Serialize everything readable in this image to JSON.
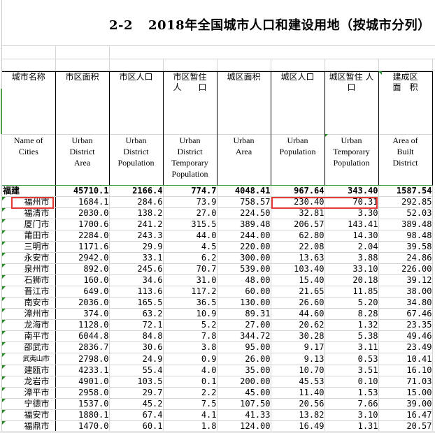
{
  "title": {
    "number": "2-2",
    "text": "2018年全国城市人口和建设用地（按城市分列）"
  },
  "columns": [
    {
      "cn": "城市名称",
      "en": "Name of\nCities"
    },
    {
      "cn": "市区面积",
      "en": "Urban\nDistrict\nArea"
    },
    {
      "cn": "市区人口",
      "en": "Urban\nDistrict\nPopulation"
    },
    {
      "cn": "市区暂住\n人　　口",
      "en": "Urban\nDistrict\nTemporary\nPopulation"
    },
    {
      "cn": "城区面积",
      "en": "Urban\nArea"
    },
    {
      "cn": "城区人口",
      "en": "Urban\nPopulation"
    },
    {
      "cn": "城区暂住 人\n口",
      "en": "Urban\nTemporary\nPopulation"
    },
    {
      "cn": "建成区\n面　积",
      "en": "Area of\nBuilt\nDistrict"
    }
  ],
  "province": {
    "name": "福建",
    "values": [
      "45710.1",
      "2166.4",
      "774.7",
      "4048.41",
      "967.64",
      "343.40",
      "1587.54"
    ]
  },
  "rows": [
    {
      "name": "福州市",
      "values": [
        "1684.1",
        "284.6",
        "73.9",
        "758.57",
        "230.40",
        "70.31",
        "292.85"
      ]
    },
    {
      "name": "福清市",
      "values": [
        "2030.0",
        "138.2",
        "27.0",
        "224.50",
        "32.81",
        "3.30",
        "52.03"
      ]
    },
    {
      "name": "厦门市",
      "values": [
        "1700.6",
        "241.2",
        "315.5",
        "389.48",
        "206.57",
        "143.41",
        "389.48"
      ]
    },
    {
      "name": "莆田市",
      "values": [
        "2284.0",
        "243.3",
        "44.0",
        "244.00",
        "62.80",
        "14.30",
        "98.48"
      ]
    },
    {
      "name": "三明市",
      "values": [
        "1171.6",
        "29.9",
        "4.5",
        "220.00",
        "22.08",
        "2.04",
        "39.58"
      ]
    },
    {
      "name": "永安市",
      "values": [
        "2942.0",
        "33.1",
        "6.2",
        "300.00",
        "13.63",
        "3.88",
        "24.86"
      ]
    },
    {
      "name": "泉州市",
      "values": [
        "892.0",
        "245.6",
        "70.7",
        "539.00",
        "103.40",
        "33.10",
        "226.00"
      ]
    },
    {
      "name": "石狮市",
      "values": [
        "160.0",
        "34.6",
        "31.0",
        "48.00",
        "15.40",
        "20.18",
        "39.12"
      ]
    },
    {
      "name": "晋江市",
      "values": [
        "649.0",
        "113.6",
        "117.2",
        "60.00",
        "21.65",
        "11.85",
        "38.00"
      ]
    },
    {
      "name": "南安市",
      "values": [
        "2036.0",
        "165.5",
        "36.5",
        "130.00",
        "26.60",
        "5.20",
        "34.80"
      ]
    },
    {
      "name": "漳州市",
      "values": [
        "374.0",
        "63.2",
        "10.9",
        "89.31",
        "44.60",
        "8.28",
        "67.46"
      ]
    },
    {
      "name": "龙海市",
      "values": [
        "1128.0",
        "72.1",
        "5.2",
        "27.00",
        "20.62",
        "1.32",
        "23.35"
      ]
    },
    {
      "name": "南平市",
      "values": [
        "6044.8",
        "84.8",
        "7.8",
        "344.72",
        "30.28",
        "5.38",
        "49.46"
      ]
    },
    {
      "name": "邵武市",
      "values": [
        "2836.7",
        "30.6",
        "3.8",
        "95.00",
        "9.17",
        "3.11",
        "23.49"
      ]
    },
    {
      "name": "武夷山市",
      "values": [
        "2798.0",
        "24.9",
        "0.9",
        "26.00",
        "9.13",
        "0.53",
        "10.41"
      ]
    },
    {
      "name": "建瓯市",
      "values": [
        "4233.1",
        "55.4",
        "4.0",
        "35.00",
        "10.70",
        "3.51",
        "16.10"
      ]
    },
    {
      "name": "龙岩市",
      "values": [
        "4901.0",
        "103.5",
        "0.1",
        "200.00",
        "45.53",
        "0.10",
        "71.03"
      ]
    },
    {
      "name": "漳平市",
      "values": [
        "2958.0",
        "29.7",
        "2.2",
        "45.00",
        "11.40",
        "1.53",
        "15.00"
      ]
    },
    {
      "name": "宁德市",
      "values": [
        "1537.0",
        "45.2",
        "7.5",
        "107.50",
        "20.56",
        "7.66",
        "39.00"
      ]
    },
    {
      "name": "福安市",
      "values": [
        "1880.1",
        "67.4",
        "4.1",
        "41.33",
        "13.82",
        "3.10",
        "16.47"
      ]
    },
    {
      "name": "福鼎市",
      "values": [
        "1470.0",
        "60.1",
        "1.8",
        "124.00",
        "16.49",
        "1.31",
        "20.57"
      ]
    }
  ],
  "highlight_color": "#e53935"
}
